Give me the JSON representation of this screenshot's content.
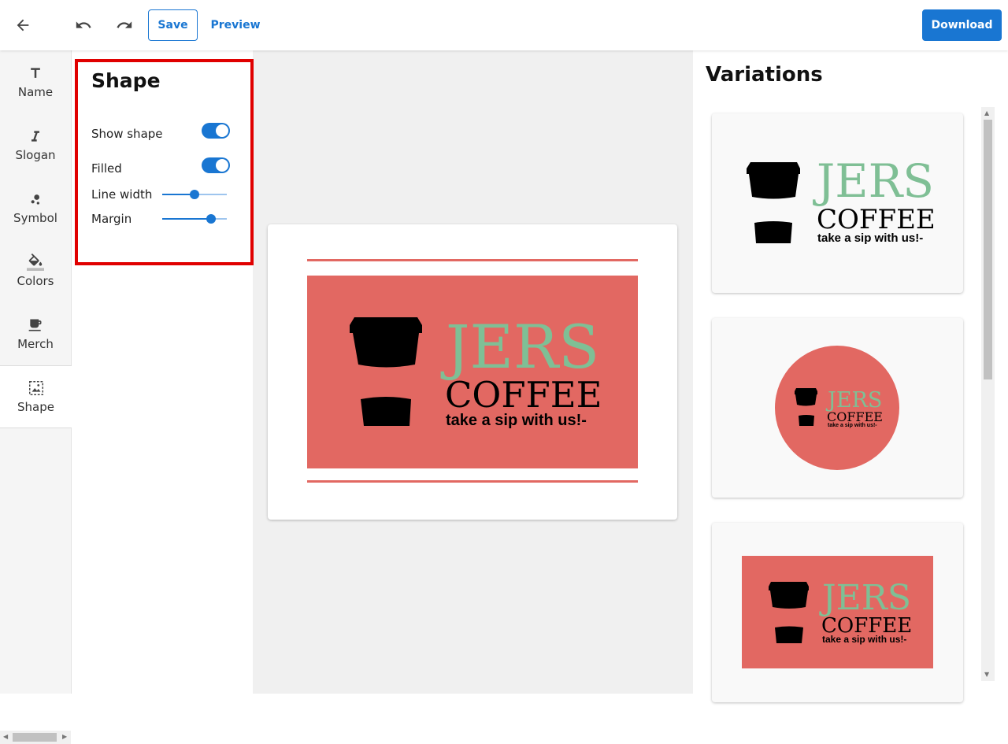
{
  "toolbar": {
    "save_label": "Save",
    "preview_label": "Preview",
    "download_label": "Download"
  },
  "sidebar": {
    "items": [
      {
        "label": "Name",
        "icon": "text-icon"
      },
      {
        "label": "Slogan",
        "icon": "italic-icon"
      },
      {
        "label": "Symbol",
        "icon": "symbol-icon"
      },
      {
        "label": "Colors",
        "icon": "paint-bucket-icon"
      },
      {
        "label": "Merch",
        "icon": "mug-icon"
      },
      {
        "label": "Shape",
        "icon": "shape-image-icon",
        "active": true
      }
    ]
  },
  "panel": {
    "title": "Shape",
    "show_shape_label": "Show shape",
    "show_shape_on": true,
    "filled_label": "Filled",
    "filled_on": true,
    "line_width_label": "Line width",
    "line_width_value": 0.5,
    "margin_label": "Margin",
    "margin_value": 0.75
  },
  "logo": {
    "name": "JERS",
    "name2": "COFFEE",
    "slogan": "take a sip with us!-",
    "colors": {
      "shape": "#e26862",
      "name": "#7fbf95",
      "text": "#000000"
    }
  },
  "variations": {
    "title": "Variations"
  },
  "colors": {
    "accent": "#1976d2",
    "highlight_box": "#e00000"
  }
}
